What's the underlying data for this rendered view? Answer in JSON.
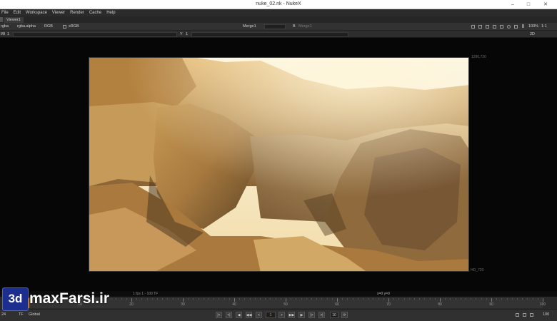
{
  "window": {
    "title": "nuke_02.nk - NukeX",
    "minimize": "–",
    "maximize": "□",
    "close": "✕"
  },
  "menu": [
    "File",
    "Edit",
    "Workspace",
    "Viewer",
    "Render",
    "Cache",
    "Help"
  ],
  "tabs": [
    {
      "label": "Viewer1"
    }
  ],
  "toolbar": {
    "layer": "rgba",
    "channel_alpha": "rgba.alpha",
    "channels": "RGB",
    "colorspace": "sRGB",
    "input_a": "Merge1",
    "input_b": "B",
    "input_b_node": "Merge1",
    "zoom": "100%",
    "proxy": "1:1",
    "gain_label": "f/8",
    "gain_value": "1",
    "gamma_label": "Y",
    "gamma_value": "1",
    "view_mode": "2D"
  },
  "viewer": {
    "format_top": "1280,720",
    "format_bottom": "HD_720",
    "coordinates": "x=0 y=0"
  },
  "timeline": {
    "info": "1 fps  1 - 100  TF",
    "ticks": [
      "1",
      "10",
      "20",
      "30",
      "40",
      "50",
      "60",
      "70",
      "80",
      "90",
      "100"
    ],
    "current_frame_fraction": 0.0
  },
  "playbar": {
    "fps_label": "24",
    "fps_mode": "TF",
    "scope": "Global",
    "current_frame": "1",
    "increment": "10",
    "end_frame": "100"
  },
  "watermark": {
    "badge": "3d",
    "text": "maxFarsi.ir"
  }
}
